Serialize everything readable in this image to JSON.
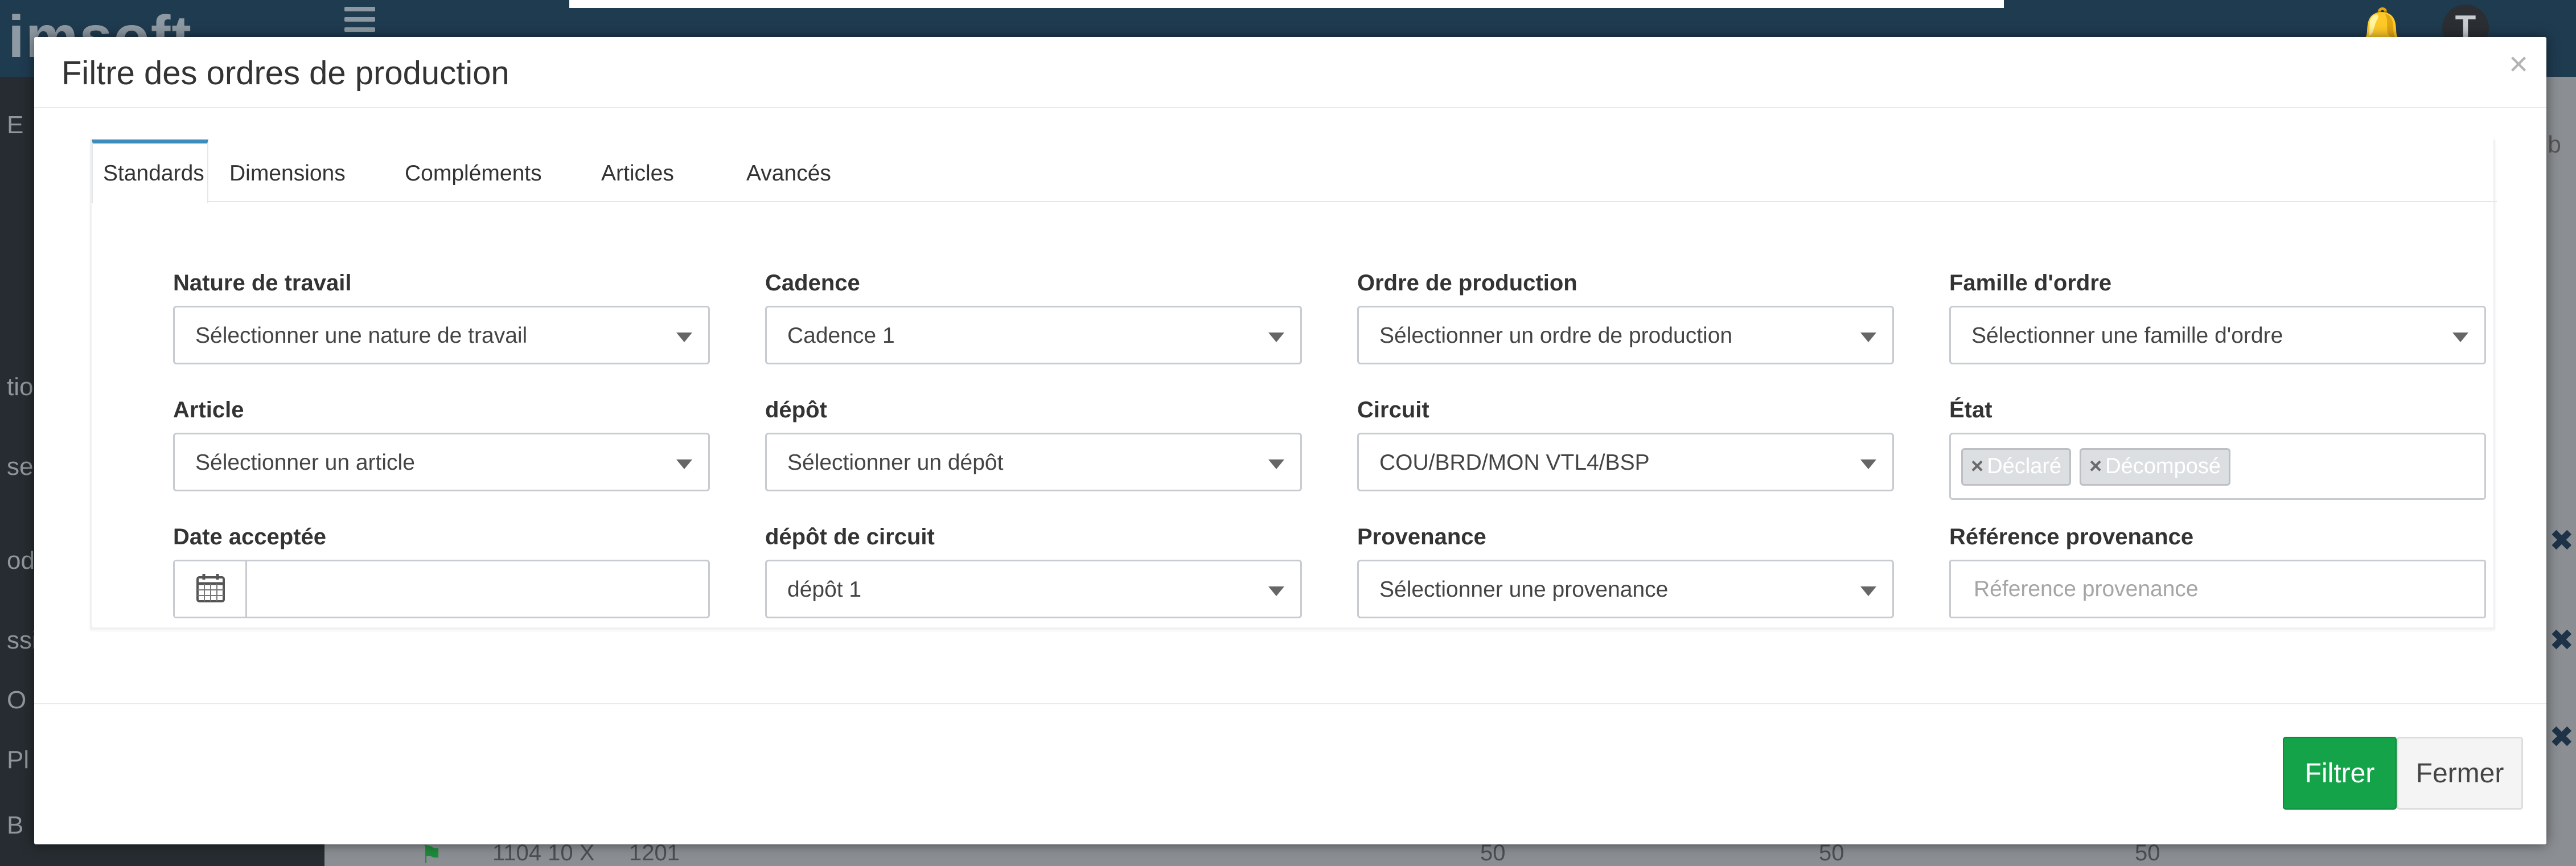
{
  "background": {
    "logo": "imsoft",
    "sidebar_fragments": [
      "E",
      "tio",
      "ses",
      "odu",
      "ssie",
      "O",
      "Pl",
      "B"
    ],
    "right_fragment": "ib",
    "row_fragment": {
      "code": "1104 10 X",
      "num": "1201",
      "values": [
        "50",
        "50",
        "50"
      ]
    }
  },
  "modal": {
    "title": "Filtre des ordres de production",
    "close_glyph": "×",
    "tabs": [
      "Standards",
      "Dimensions",
      "Compléments",
      "Articles",
      "Avancés"
    ],
    "active_tab": "Standards",
    "fields": {
      "nature_travail": {
        "label": "Nature de travail",
        "value": "Sélectionner une nature de travail"
      },
      "cadence": {
        "label": "Cadence",
        "value": "Cadence 1"
      },
      "ordre_production": {
        "label": "Ordre de production",
        "value": "Sélectionner un ordre de production"
      },
      "famille_ordre": {
        "label": "Famille d'ordre",
        "value": "Sélectionner une famille d'ordre"
      },
      "article": {
        "label": "Article",
        "value": "Sélectionner un article"
      },
      "depot": {
        "label": "dépôt",
        "value": "Sélectionner un dépôt"
      },
      "circuit": {
        "label": "Circuit",
        "value": "COU/BRD/MON VTL4/BSP"
      },
      "etat": {
        "label": "État",
        "tags": [
          "Déclaré",
          "Décomposé"
        ],
        "tag_remove": "×"
      },
      "date_acceptee": {
        "label": "Date acceptée",
        "value": ""
      },
      "depot_circuit": {
        "label": "dépôt de circuit",
        "value": "dépôt 1"
      },
      "provenance": {
        "label": "Provenance",
        "value": "Sélectionner une provenance"
      },
      "reference_provenance": {
        "label": "Référence provenance",
        "placeholder": "Réference provenance"
      }
    },
    "buttons": {
      "filter": "Filtrer",
      "close": "Fermer"
    }
  },
  "colors": {
    "primary_green": "#15a34a",
    "tab_accent": "#3c8dbc",
    "topbar": "#1f3b50"
  },
  "icons": {
    "calendar": "calendar-icon",
    "dropdown": "caret-down-icon",
    "close": "close-icon",
    "bell": "bell-icon",
    "menu": "hamburger-menu-icon"
  }
}
